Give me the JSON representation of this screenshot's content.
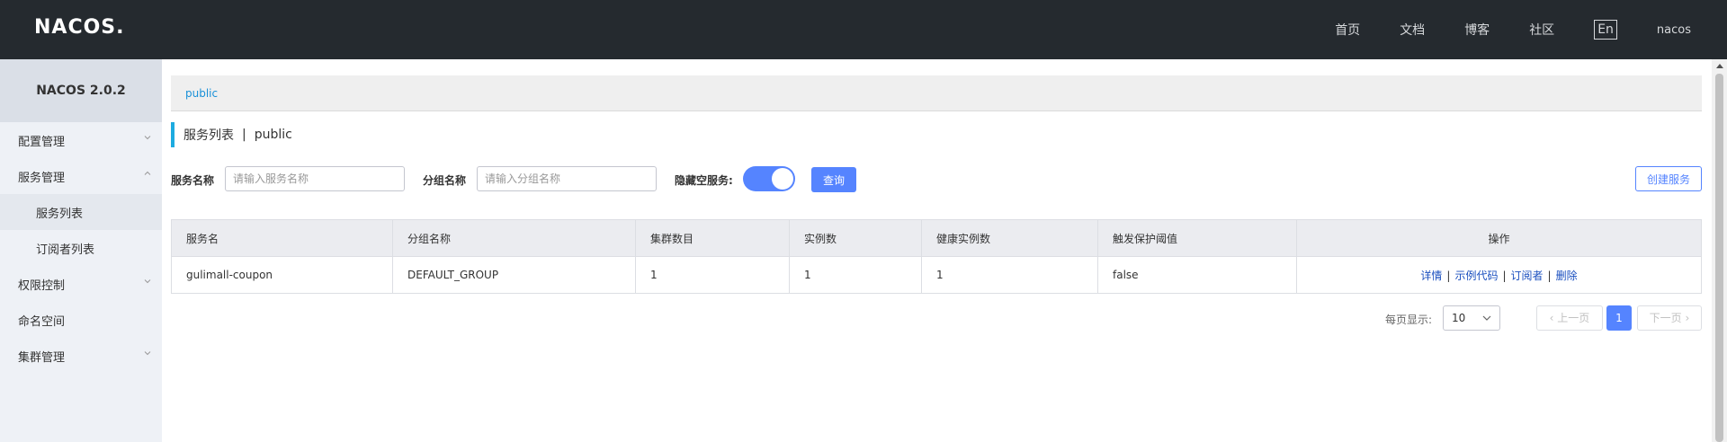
{
  "header": {
    "logo": "NACOS.",
    "nav": [
      "首页",
      "文档",
      "博客",
      "社区"
    ],
    "lang": "En",
    "user": "nacos"
  },
  "sidebar": {
    "brand": "NACOS 2.0.2",
    "items": [
      {
        "label": "配置管理",
        "expanded": false
      },
      {
        "label": "服务管理",
        "expanded": true
      },
      {
        "label": "服务列表",
        "sub": true,
        "active": true
      },
      {
        "label": "订阅者列表",
        "sub": true
      },
      {
        "label": "权限控制",
        "expanded": false
      },
      {
        "label": "命名空间"
      },
      {
        "label": "集群管理",
        "expanded": false
      }
    ]
  },
  "breadcrumb": "public",
  "page_title": {
    "main": "服务列表",
    "sep": "|",
    "namespace": "public"
  },
  "filter": {
    "service_label": "服务名称",
    "service_placeholder": "请输入服务名称",
    "group_label": "分组名称",
    "group_placeholder": "请输入分组名称",
    "hide_empty_label": "隐藏空服务:",
    "hide_empty_on": true,
    "query_button": "查询",
    "create_button": "创建服务"
  },
  "table": {
    "headers": [
      "服务名",
      "分组名称",
      "集群数目",
      "实例数",
      "健康实例数",
      "触发保护阈值",
      "操作"
    ],
    "rows": [
      {
        "cells": [
          "gulimall-coupon",
          "DEFAULT_GROUP",
          "1",
          "1",
          "1",
          "false"
        ],
        "actions": [
          "详情",
          "示例代码",
          "订阅者",
          "删除"
        ]
      }
    ]
  },
  "pagination": {
    "per_page_label": "每页显示:",
    "per_page": "10",
    "prev": "上一页",
    "next": "下一页",
    "current": "1"
  },
  "colors": {
    "primary": "#5584ff",
    "header_bg": "#252a2f",
    "accent_bar": "#1dabe0"
  }
}
